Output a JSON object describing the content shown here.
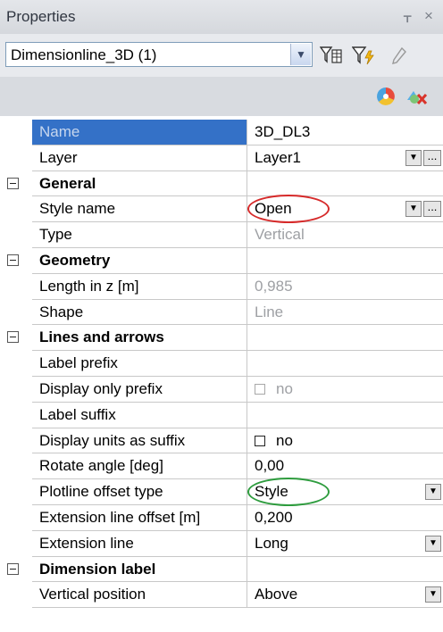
{
  "panel": {
    "title": "Properties",
    "pin_glyph": "ᚁ",
    "close_glyph": "×",
    "selector_value": "Dimensionline_3D (1)",
    "tools": [
      "filter-table-icon",
      "filter-lightning-icon",
      "pencil-icon"
    ],
    "tools2": [
      "color-wheel-icon",
      "delete-multicolor-icon"
    ]
  },
  "rows": [
    {
      "kind": "prop",
      "label": "Name",
      "value": "3D_DL3",
      "selected": true
    },
    {
      "kind": "prop",
      "label": "Layer",
      "value": "Layer1",
      "control": "dropdown-more"
    },
    {
      "kind": "cat",
      "label": "General"
    },
    {
      "kind": "prop",
      "label": "Style name",
      "value": "Open",
      "control": "dropdown-more",
      "highlight": "red"
    },
    {
      "kind": "prop",
      "label": "Type",
      "value": "Vertical",
      "dim": true
    },
    {
      "kind": "cat",
      "label": "Geometry"
    },
    {
      "kind": "prop",
      "label": "Length in z [m]",
      "value": "0,985",
      "dim": true
    },
    {
      "kind": "prop",
      "label": "Shape",
      "value": "Line",
      "dim": true
    },
    {
      "kind": "cat",
      "label": "Lines and arrows"
    },
    {
      "kind": "prop",
      "label": "Label prefix",
      "value": ""
    },
    {
      "kind": "prop",
      "label": "Display only prefix",
      "value": "no",
      "checkbox": true,
      "dim": true
    },
    {
      "kind": "prop",
      "label": "Label suffix",
      "value": ""
    },
    {
      "kind": "prop",
      "label": "Display units as suffix",
      "value": "no",
      "checkbox": true
    },
    {
      "kind": "prop",
      "label": "Rotate angle [deg]",
      "value": "0,00"
    },
    {
      "kind": "prop",
      "label": "Plotline offset type",
      "value": "Style",
      "control": "dropdown",
      "highlight": "green"
    },
    {
      "kind": "prop",
      "label": "Extension line offset [m]",
      "value": "0,200"
    },
    {
      "kind": "prop",
      "label": "Extension line",
      "value": "Long",
      "control": "dropdown"
    },
    {
      "kind": "cat",
      "label": "Dimension label"
    },
    {
      "kind": "prop",
      "label": "Vertical position",
      "value": "Above",
      "control": "dropdown"
    }
  ],
  "colors": {
    "selected_row": "#3471c7",
    "highlight_red": "#d62a2a",
    "highlight_green": "#2e9c3e"
  }
}
